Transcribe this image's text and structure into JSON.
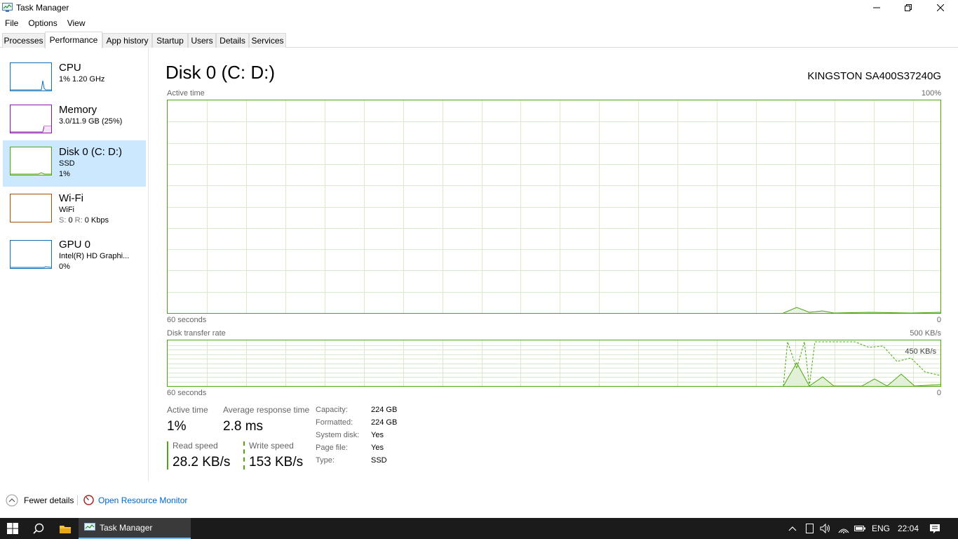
{
  "window": {
    "title": "Task Manager",
    "menu": [
      "File",
      "Options",
      "View"
    ],
    "tabs": [
      "Processes",
      "Performance",
      "App history",
      "Startup",
      "Users",
      "Details",
      "Services"
    ]
  },
  "sidebar": {
    "items": [
      {
        "title": "CPU",
        "line1": "1% 1.20 GHz",
        "line2": "",
        "color": "#1170b8"
      },
      {
        "title": "Memory",
        "line1": "3.0/11.9 GB (25%)",
        "line2": "",
        "color": "#8b12ae"
      },
      {
        "title": "Disk 0 (C: D:)",
        "line1": "SSD",
        "line2": "1%",
        "color": "#4da60c"
      },
      {
        "title": "Wi-Fi",
        "line1": "WiFi",
        "line2_prefix": "S:",
        "line2_s": "0",
        "line2_r_prefix": "R:",
        "line2_r": "0 Kbps",
        "color": "#a74f01"
      },
      {
        "title": "GPU 0",
        "line1": "Intel(R) HD Graphi...",
        "line2": "0%",
        "color": "#1170b8"
      }
    ]
  },
  "main": {
    "title": "Disk 0 (C: D:)",
    "model": "KINGSTON SA400S37240G",
    "active_time_graph": {
      "label": "Active time",
      "max_label": "100%",
      "time_label": "60 seconds",
      "min_label": "0"
    },
    "transfer_graph": {
      "label": "Disk transfer rate",
      "max_label": "500 KB/s",
      "inner_label": "450 KB/s",
      "time_label": "60 seconds",
      "min_label": "0"
    }
  },
  "stats": {
    "active_time_label": "Active time",
    "active_time_value": "1%",
    "avg_response_label": "Average response time",
    "avg_response_value": "2.8 ms",
    "read_speed_label": "Read speed",
    "read_speed_value": "28.2 KB/s",
    "write_speed_label": "Write speed",
    "write_speed_value": "153 KB/s",
    "props": [
      {
        "label": "Capacity:",
        "value": "224 GB"
      },
      {
        "label": "Formatted:",
        "value": "224 GB"
      },
      {
        "label": "System disk:",
        "value": "Yes"
      },
      {
        "label": "Page file:",
        "value": "Yes"
      },
      {
        "label": "Type:",
        "value": "SSD"
      }
    ]
  },
  "footer": {
    "fewer_details": "Fewer details",
    "resource_monitor": "Open Resource Monitor"
  },
  "taskbar": {
    "app_label": "Task Manager",
    "language": "ENG",
    "time": "22:04"
  },
  "colors": {
    "disk_green": "#4da60c",
    "selected_bg": "#cce8ff",
    "link_blue": "#0066cc",
    "taskbar_bg": "#1b1b1b"
  }
}
